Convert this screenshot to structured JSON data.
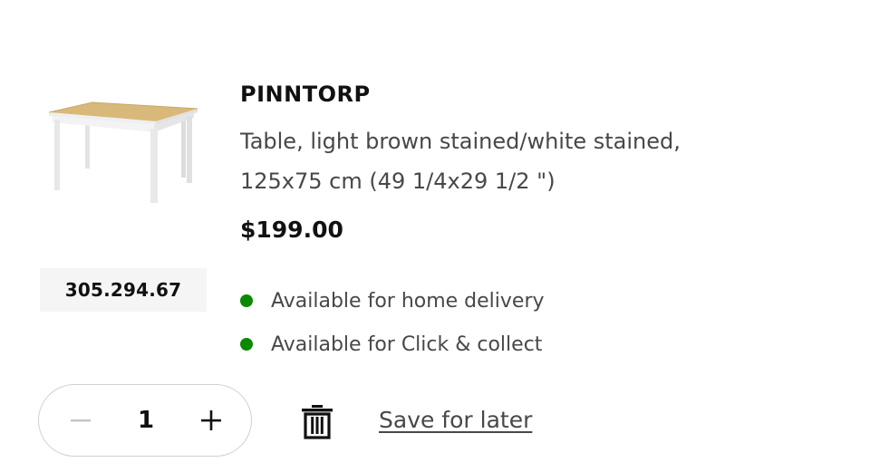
{
  "product": {
    "image_icon": "table-image",
    "article_number": "305.294.67",
    "name": "PINNTORP",
    "description_line1": "Table, light brown stained/white stained,",
    "description_line2": "125x75 cm (49 1/4x29 1/2 \")",
    "price": "$199.00"
  },
  "availability": [
    {
      "text": "Available for home delivery",
      "status_color": "#0a8a00"
    },
    {
      "text": "Available for Click & collect",
      "status_color": "#0a8a00"
    }
  ],
  "quantity": {
    "value": "1",
    "decrement_icon": "minus-icon",
    "increment_icon": "plus-icon"
  },
  "actions": {
    "remove_icon": "trash-icon",
    "save_for_later_label": "Save for later"
  }
}
